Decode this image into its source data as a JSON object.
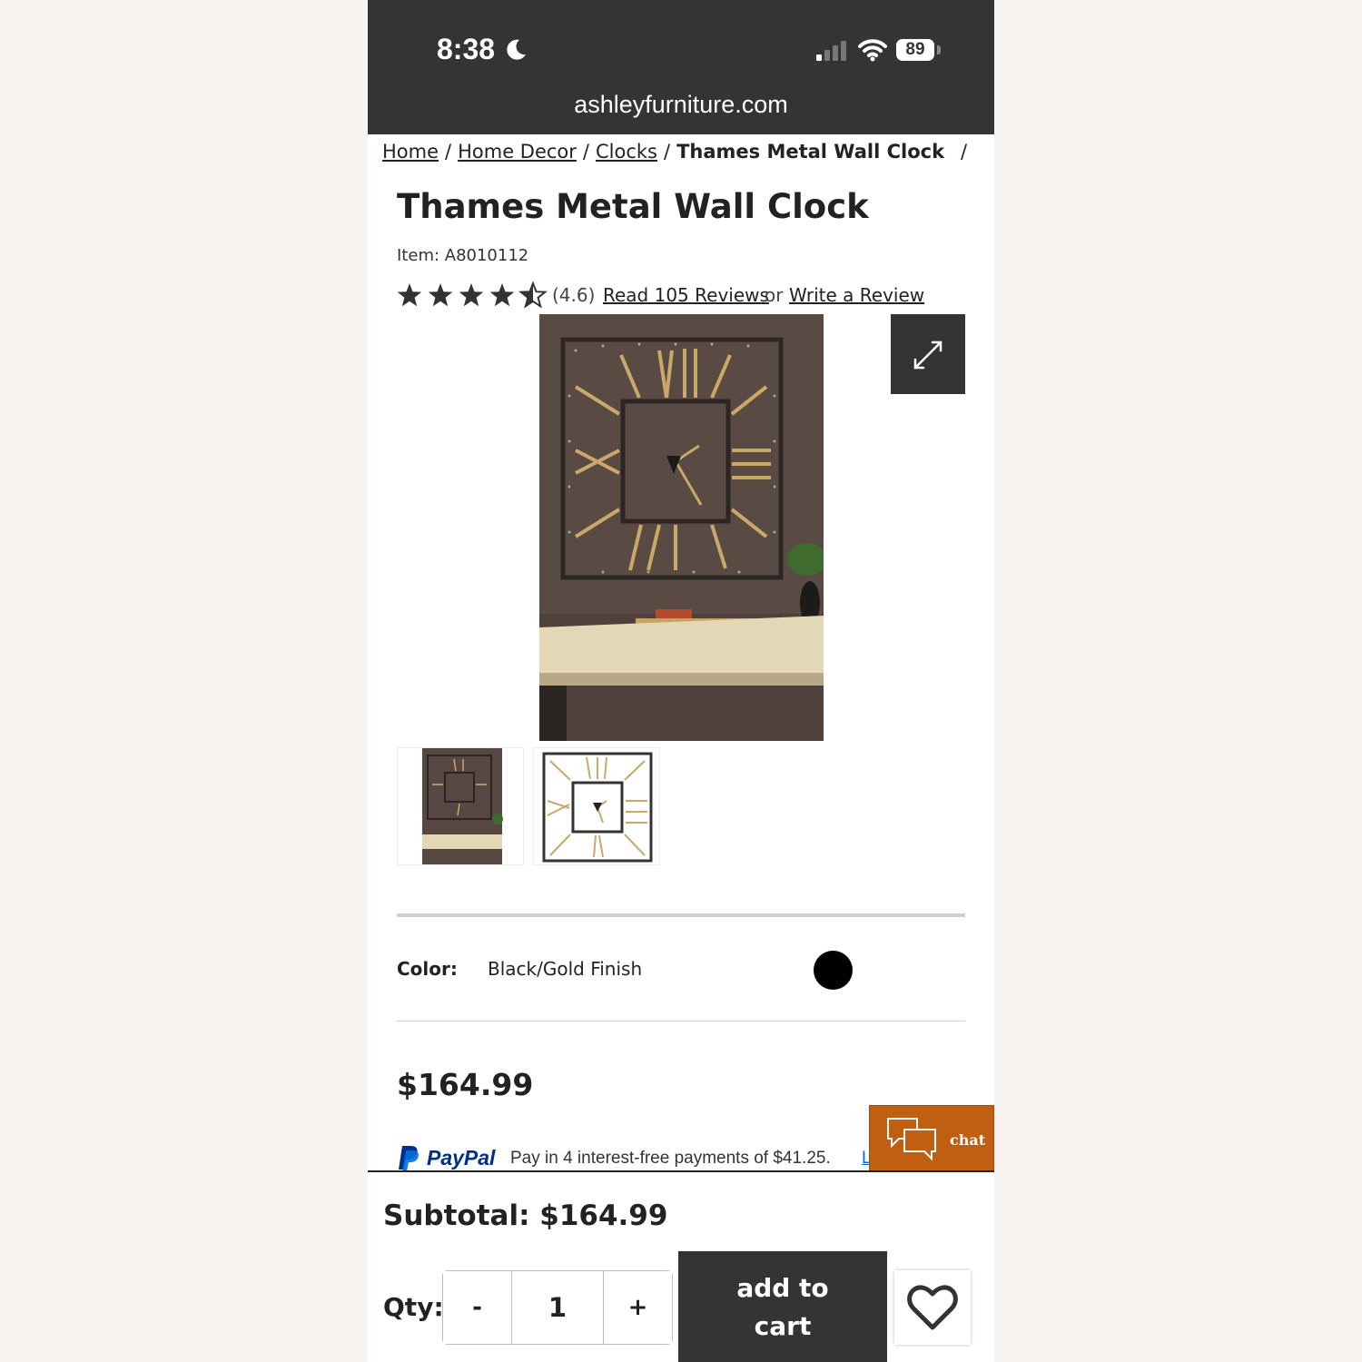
{
  "status_bar": {
    "time": "8:38",
    "battery": "89",
    "url": "ashleyfurniture.com"
  },
  "breadcrumb": {
    "items": [
      "Home",
      "Home Decor",
      "Clocks"
    ],
    "current": "Thames Metal Wall Clock",
    "separator": "/"
  },
  "product": {
    "title": "Thames Metal Wall Clock",
    "item_number": "Item: A8010112",
    "rating": "(4.6)",
    "rating_value": 4.6,
    "read_reviews": "Read 105 Reviews",
    "or": "or",
    "write_review": "Write a Review",
    "color_label": "Color:",
    "color_value": "Black/Gold Finish",
    "swatch_color": "#000000",
    "price": "$164.99"
  },
  "paypal": {
    "brand": "PayPal",
    "message": "Pay in 4 interest-free payments of $41.25.",
    "link": "L"
  },
  "chat": {
    "label": "chat",
    "color": "#c05f12"
  },
  "cart_bar": {
    "subtotal": "Subtotal: $164.99",
    "qty_label": "Qty:",
    "minus": "-",
    "quantity": "1",
    "plus": "+",
    "add_to_cart": "add to cart"
  },
  "icons": [
    "moon-icon",
    "signal-icon",
    "wifi-icon",
    "expand-icon",
    "star-icon",
    "paypal-icon",
    "chat-icon",
    "heart-icon"
  ]
}
